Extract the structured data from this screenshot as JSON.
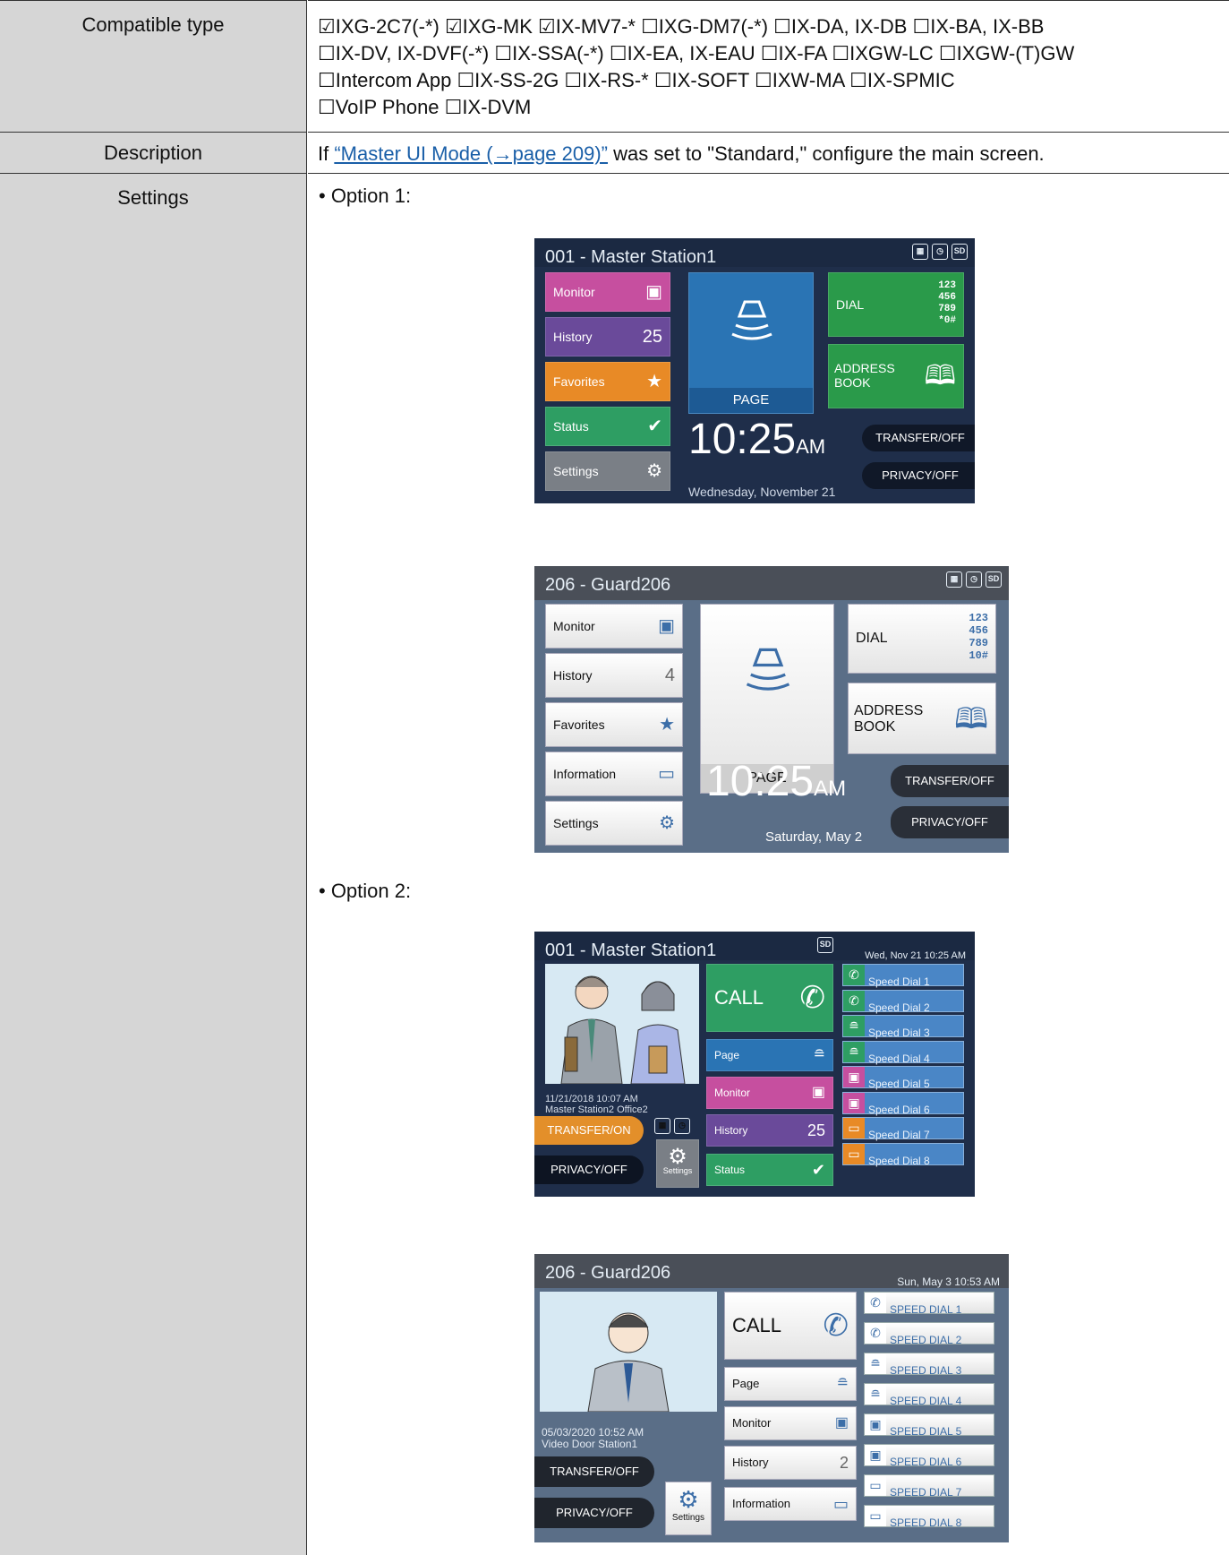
{
  "rows": {
    "compatible_label": "Compatible type",
    "compatible_lines": [
      "☑IXG-2C7(-*) ☑IXG-MK ☑IX-MV7-* ☐IXG-DM7(-*) ☐IX-DA, IX-DB ☐IX-BA, IX-BB",
      "☐IX-DV, IX-DVF(-*) ☐IX-SSA(-*) ☐IX-EA, IX-EAU ☐IX-FA ☐IXGW-LC ☐IXGW-(T)GW",
      "☐Intercom App ☐IX-SS-2G ☐IX-RS-* ☐IX-SOFT ☐IXW-MA ☐IX-SPMIC",
      "☐VoIP Phone ☐IX-DVM"
    ],
    "description_label": "Description",
    "description_pre": "If ",
    "description_link": "“Master UI Mode (→page 209)”",
    "description_post": " was set to \"Standard,\" configure the main screen.",
    "settings_label": "Settings",
    "option1": "• Option 1:",
    "option2": "• Option 2:"
  },
  "icons": [
    "checkbox-checked-icon",
    "checkbox-empty-icon",
    "monitor-icon",
    "star-icon",
    "check-icon",
    "gear-icon",
    "keypad-icon",
    "book-icon",
    "speaker-icon",
    "phone-icon",
    "info-icon",
    "sd-card-icon",
    "schedule-icon"
  ],
  "colors": {
    "link": "#1a5fa8",
    "header_bg": "#d6d6d6",
    "monitor": "#c64f9f",
    "history": "#6a4a9a",
    "favorites": "#e88a26",
    "status": "#2e9e63",
    "settings": "#7a7f86",
    "page_blue": "#2a74b4",
    "dial_green": "#2a9a4a",
    "transfer_on": "#e38f2a"
  },
  "screen1": {
    "title": "001 - Master Station1",
    "buttons": [
      "Monitor",
      "History",
      "Favorites",
      "Status",
      "Settings"
    ],
    "history_count": "25",
    "page": "PAGE",
    "dial": "DIAL",
    "address_book_1": "ADDRESS",
    "address_book_2": "BOOK",
    "transfer": "TRANSFER/OFF",
    "privacy": "PRIVACY/OFF",
    "time": "10:25",
    "ampm": "AM",
    "date": "Wednesday, November 21",
    "keypad": [
      "123",
      "456",
      "789",
      "*0#"
    ]
  },
  "screen2": {
    "title": "206 - Guard206",
    "buttons": [
      "Monitor",
      "History",
      "Favorites",
      "Information",
      "Settings"
    ],
    "history_count": "4",
    "page": "PAGE",
    "dial": "DIAL",
    "address_book_1": "ADDRESS",
    "address_book_2": "BOOK",
    "transfer": "TRANSFER/OFF",
    "privacy": "PRIVACY/OFF",
    "time": "10:25",
    "ampm": "AM",
    "date": "Saturday, May 2",
    "keypad": [
      "123",
      "456",
      "789",
      "10#"
    ]
  },
  "screen3": {
    "title": "001 - Master Station1",
    "datetime": "Wed, Nov 21 10:25 AM",
    "call": "CALL",
    "page": "Page",
    "monitor": "Monitor",
    "history": "History",
    "history_count": "25",
    "status": "Status",
    "settings": "Settings",
    "log_time": "11/21/2018 10:07 AM",
    "log_station": "Master Station2 Office2",
    "transfer": "TRANSFER/ON",
    "privacy": "PRIVACY/OFF",
    "speed_dials": [
      {
        "label": "Speed Dial 1",
        "kind": "phone",
        "color": "#2e9e63"
      },
      {
        "label": "Speed Dial 2",
        "kind": "phone",
        "color": "#2e9e63"
      },
      {
        "label": "Speed Dial 3",
        "kind": "page",
        "color": "#2e9e63"
      },
      {
        "label": "Speed Dial 4",
        "kind": "page",
        "color": "#2e9e63"
      },
      {
        "label": "Speed Dial 5",
        "kind": "monitor",
        "color": "#c64f9f"
      },
      {
        "label": "Speed Dial 6",
        "kind": "monitor",
        "color": "#c64f9f"
      },
      {
        "label": "Speed Dial 7",
        "kind": "info",
        "color": "#e88a26"
      },
      {
        "label": "Speed Dial 8",
        "kind": "info",
        "color": "#e88a26"
      }
    ]
  },
  "screen4": {
    "title": "206 - Guard206",
    "datetime": "Sun, May 3 10:53 AM",
    "call": "CALL",
    "page": "Page",
    "monitor": "Monitor",
    "history": "History",
    "history_count": "2",
    "information": "Information",
    "settings": "Settings",
    "log_time": "05/03/2020 10:52 AM",
    "log_station": "Video Door Station1",
    "transfer": "TRANSFER/OFF",
    "privacy": "PRIVACY/OFF",
    "speed_dials": [
      {
        "label": "SPEED DIAL 1",
        "kind": "phone"
      },
      {
        "label": "SPEED DIAL 2",
        "kind": "phone"
      },
      {
        "label": "SPEED DIAL 3",
        "kind": "page"
      },
      {
        "label": "SPEED DIAL 4",
        "kind": "page"
      },
      {
        "label": "SPEED DIAL 5",
        "kind": "monitor"
      },
      {
        "label": "SPEED DIAL 6",
        "kind": "monitor"
      },
      {
        "label": "SPEED DIAL 7",
        "kind": "info"
      },
      {
        "label": "SPEED DIAL 8",
        "kind": "info"
      }
    ]
  }
}
